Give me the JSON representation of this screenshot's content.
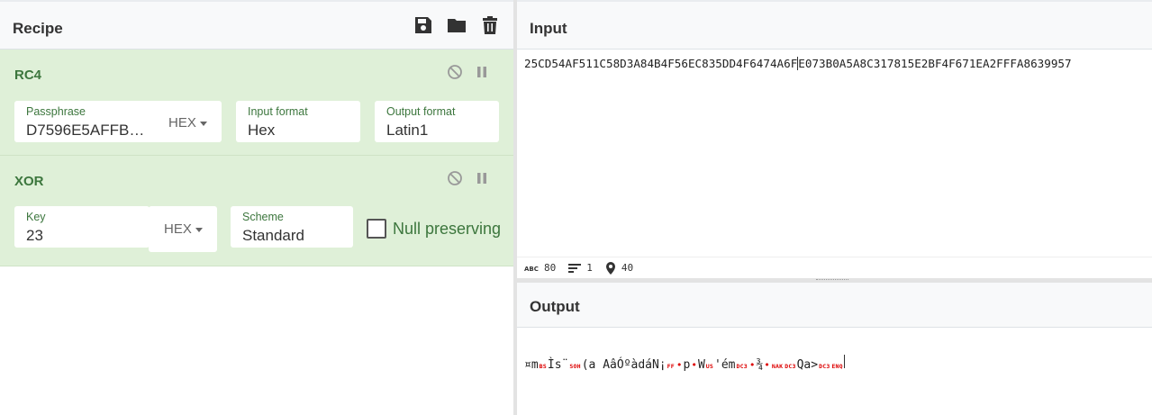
{
  "recipe": {
    "title": "Recipe",
    "icons": [
      "save-icon",
      "folder-icon",
      "trash-icon"
    ],
    "operations": {
      "rc4": {
        "title": "RC4",
        "passphrase_label": "Passphrase",
        "passphrase_value": "D7596E5AFFBE...",
        "passphrase_format": "HEX",
        "input_format_label": "Input format",
        "input_format_value": "Hex",
        "output_format_label": "Output format",
        "output_format_value": "Latin1"
      },
      "xor": {
        "title": "XOR",
        "key_label": "Key",
        "key_value": "23",
        "key_format": "HEX",
        "scheme_label": "Scheme",
        "scheme_value": "Standard",
        "null_preserving_label": "Null preserving"
      }
    }
  },
  "input": {
    "title": "Input",
    "text_before_cursor": "25CD54AF511C58D3A84B4F56EC835DD4F6474A6F",
    "text_after_cursor": "E073B0A5A8C317815E2BF4F671EA2FFFA8639957",
    "stats": {
      "chars": "80",
      "lines": "1",
      "position": "40"
    }
  },
  "output": {
    "title": "Output",
    "segments": [
      "¤m",
      "BS",
      "Ìs¨",
      "SOH",
      "(a AâÓºàdáN¡",
      "FF",
      "•",
      "p",
      "•",
      "W",
      "US",
      "'ém",
      "DC3",
      "•",
      "¾",
      "•",
      "NAK",
      "DC3",
      "Qa>",
      "DC3",
      "ENQ"
    ]
  },
  "colors": {
    "op_background": "#dff0d8",
    "op_text": "#3c763d",
    "control_char": "#dd0000"
  }
}
